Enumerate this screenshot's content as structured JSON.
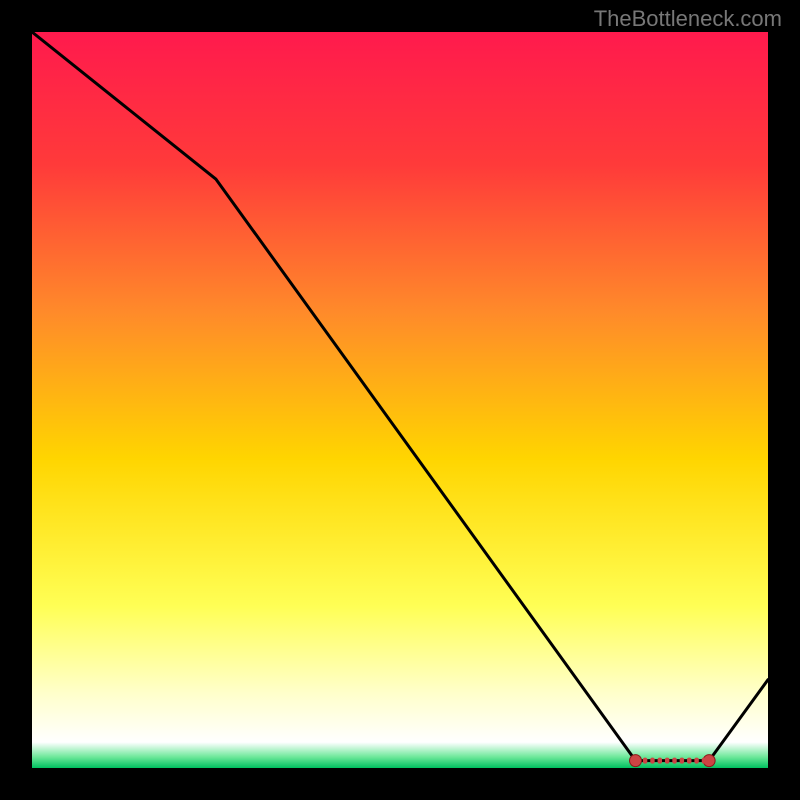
{
  "watermark": "TheBottleneck.com",
  "chart_data": {
    "type": "line",
    "title": "",
    "xlabel": "",
    "ylabel": "",
    "xlim": [
      0,
      100
    ],
    "ylim": [
      0,
      100
    ],
    "x": [
      0,
      25,
      82,
      92,
      100
    ],
    "values": [
      100,
      80,
      1,
      1,
      12
    ],
    "marker_range_x": [
      82,
      92
    ],
    "gradient_stops": [
      {
        "pos": 0.0,
        "color": "#ff1a4d"
      },
      {
        "pos": 0.18,
        "color": "#ff3a3a"
      },
      {
        "pos": 0.38,
        "color": "#ff8a2a"
      },
      {
        "pos": 0.58,
        "color": "#ffd500"
      },
      {
        "pos": 0.78,
        "color": "#ffff55"
      },
      {
        "pos": 0.9,
        "color": "#ffffcc"
      },
      {
        "pos": 0.965,
        "color": "#ffffff"
      },
      {
        "pos": 0.985,
        "color": "#6de89a"
      },
      {
        "pos": 1.0,
        "color": "#00c060"
      }
    ]
  }
}
